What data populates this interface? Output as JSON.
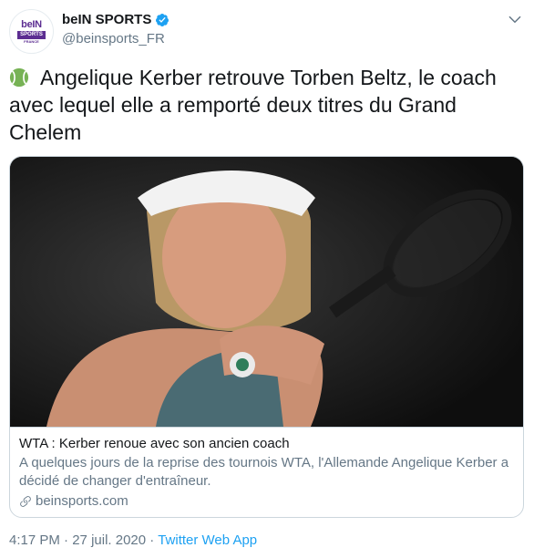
{
  "account": {
    "display_name": "beIN SPORTS",
    "handle": "@beinsports_FR",
    "avatar_text_top": "beIN",
    "avatar_text_mid": "SPORTS",
    "avatar_text_bottom": "FRANCE"
  },
  "tweet": {
    "text": "Angelique Kerber retrouve Torben Beltz, le coach avec lequel elle a remporté deux titres du Grand Chelem",
    "emoji_icon": "tennis-ball-icon"
  },
  "card": {
    "image_alt_subject": "tennis player with racket",
    "title": "WTA : Kerber renoue avec son ancien coach",
    "description": "A quelques jours de la reprise des tournois WTA, l'Allemande Angelique Kerber a décidé de changer d'entraîneur.",
    "domain": "beinsports.com"
  },
  "meta": {
    "time": "4:17 PM",
    "separator": " · ",
    "date": "27 juil. 2020",
    "source": "Twitter Web App"
  },
  "colors": {
    "brand_purple": "#5c2d91",
    "verified_blue": "#1da1f2",
    "secondary_text": "#657786",
    "border": "#ccd6dd"
  }
}
